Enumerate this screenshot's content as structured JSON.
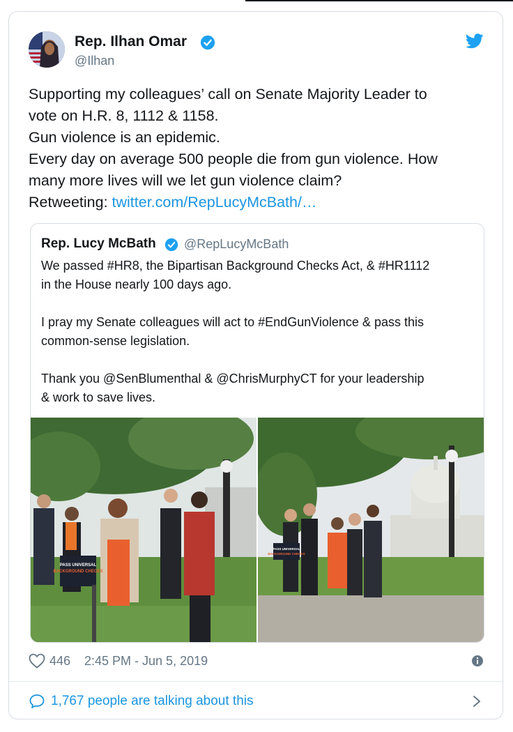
{
  "tweet": {
    "author": {
      "name": "Rep. Ilhan Omar",
      "handle": "@Ilhan",
      "verified": true
    },
    "text_lines": [
      "Supporting my colleagues’ call on Senate Majority Leader to",
      "vote on H.R. 8, 1112 & 1158.",
      "Gun violence is an epidemic.",
      "Every day on average 500 people die from gun violence. How",
      "many more lives will we let gun violence claim?"
    ],
    "retweet_prefix": "Retweeting:",
    "link_text": "twitter.com/RepLucyMcBath/…",
    "quoted": {
      "name": "Rep. Lucy McBath",
      "handle": "@RepLucyMcBath",
      "verified": true,
      "paragraphs": [
        [
          "We passed #HR8, the Bipartisan Background Checks Act, & #HR1112",
          "in the House nearly 100 days ago."
        ],
        [
          "I pray my Senate colleagues will act to #EndGunViolence & pass this",
          "common-sense legislation."
        ],
        [
          "Thank you @SenBlumenthal & @ChrisMurphyCT for your leadership",
          "& work to save lives."
        ]
      ],
      "photo_signs": [
        {
          "line1": "PASS UNIVERSAL",
          "line2": "BACKGROUND CHECKS"
        },
        {
          "line1": "PASS UNIVERSAL",
          "line2": "BACKGROUND CHECKS"
        }
      ]
    },
    "likes": "446",
    "timestamp": "2:45 PM - Jun 5, 2019",
    "talking": "1,767 people are talking about this"
  },
  "icons": [
    "verified-badge-icon",
    "twitter-bird-icon",
    "heart-icon",
    "info-icon",
    "reply-bubble-icon",
    "chevron-right-icon"
  ],
  "colors": {
    "link": "#1b95e0",
    "muted": "#657786",
    "text": "#14171a",
    "border": "#d8dde2"
  }
}
